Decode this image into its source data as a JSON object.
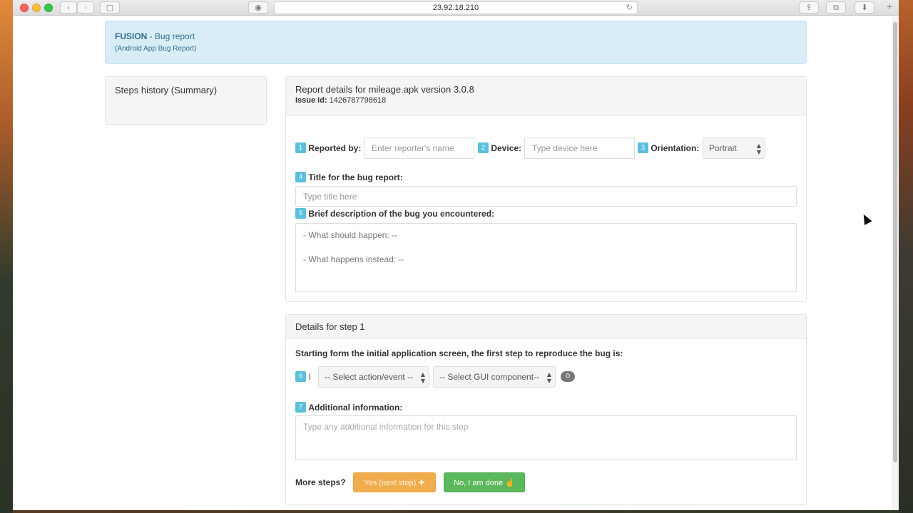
{
  "browser": {
    "url": "23.92.18.210",
    "back_glyph": "‹",
    "forward_glyph": "›",
    "sidebar_glyph": "▢",
    "privacy_glyph": "◉",
    "reload_glyph": "↻",
    "share_glyph": "⇪",
    "tabs_glyph": "⧉",
    "download_glyph": "⬇",
    "newtab_glyph": "+"
  },
  "header": {
    "brand": "FUSION",
    "title": " - Bug report",
    "subtitle": "(Android App Bug Report)"
  },
  "steps_history": {
    "title": "Steps history (Summary)"
  },
  "report": {
    "title": "Report details for mileage.apk version 3.0.8",
    "issue_label": "Issue id:",
    "issue_id": "1426787798618",
    "fields": {
      "reported_by": {
        "num": "1",
        "label": "Reported by:",
        "placeholder": "Enter reporter's name"
      },
      "device": {
        "num": "2",
        "label": "Device:",
        "placeholder": "Type device here"
      },
      "orientation": {
        "num": "3",
        "label": "Orientation:",
        "value": "Portrait"
      },
      "title": {
        "num": "4",
        "label": "Title for the bug report:",
        "placeholder": "Type title here"
      },
      "description": {
        "num": "5",
        "label": "Brief description of the bug you encountered:",
        "line1": "- What should happen: --",
        "line2": "- What happens instead: --"
      }
    }
  },
  "step": {
    "title": "Details for step 1",
    "intro": "Starting form the initial application screen, the first step to reproduce the bug is:",
    "num6": "6",
    "cursor_char": "I",
    "action_select": "-- Select action/event --",
    "component_select": "-- Select GUI component--",
    "info_glyph": "⊙",
    "additional": {
      "num": "7",
      "label": "Additional information:",
      "placeholder": "Type any additional information for this step"
    },
    "more_steps": "More steps?",
    "yes_button": "Yes (next step) ✚",
    "no_button": "No, I am done ☝"
  },
  "colors": {
    "info_bg": "#d9edf7",
    "info_text": "#31708f",
    "badge": "#5bc0de",
    "warning": "#f0ad4e",
    "success": "#5cb85c"
  }
}
